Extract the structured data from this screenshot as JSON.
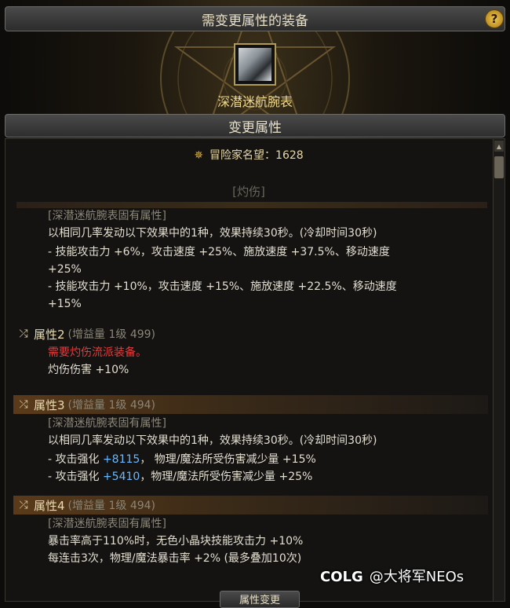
{
  "window": {
    "title": "需变更属性的装备",
    "help_label": "?"
  },
  "equipment": {
    "name": "深潜迷航腕表",
    "icon": "wristwatch-icon"
  },
  "section": {
    "title": "变更属性"
  },
  "fame": {
    "label": "冒险家名望：1628",
    "icon": "fame-star-icon"
  },
  "category_tag": "[灼伤]",
  "attr1": {
    "lines": [
      "[深潜迷航腕表固有属性]",
      "以相同几率发动以下效果中的1种，效果持续30秒。(冷却时间30秒)",
      "- 技能攻击力 +6%，攻击速度 +25%、施放速度 +37.5%、移动速度",
      "+25%",
      "- 技能攻击力 +10%，攻击速度 +15%、施放速度 +22.5%、移动速度",
      "+15%"
    ]
  },
  "attr2": {
    "title": "属性2",
    "meta": "(增益量 1级 499)",
    "requirement": "需要灼伤流派装备。",
    "effect": "灼伤伤害 +10%"
  },
  "attr3": {
    "title": "属性3",
    "meta": "(增益量 1级 494)",
    "bracket": "[深潜迷航腕表固有属性]",
    "desc": "以相同几率发动以下效果中的1种，效果持续30秒。(冷却时间30秒)",
    "opt1_prefix": "- 攻击强化 ",
    "opt1_value": "+8115",
    "opt1_suffix": "， 物理/魔法所受伤害减少量 +15%",
    "opt2_prefix": "- 攻击强化 ",
    "opt2_value": "+5410",
    "opt2_suffix": "，物理/魔法所受伤害减少量 +25%"
  },
  "attr4": {
    "title": "属性4",
    "meta": "(增益量 1级 494)",
    "bracket": "[深潜迷航腕表固有属性]",
    "line1": "暴击率高于110%时，无色小晶块技能攻击力 +10%",
    "line2": "每连击3次，物理/魔法暴击率 +2% (最多叠加10次)"
  },
  "bottom_button": "属性变更",
  "watermark": {
    "logo": "COLG",
    "text": "@大将军NEOs"
  },
  "colors": {
    "gold": "#f0d98a",
    "red": "#e23c3c",
    "blue": "#6ab8ff"
  }
}
